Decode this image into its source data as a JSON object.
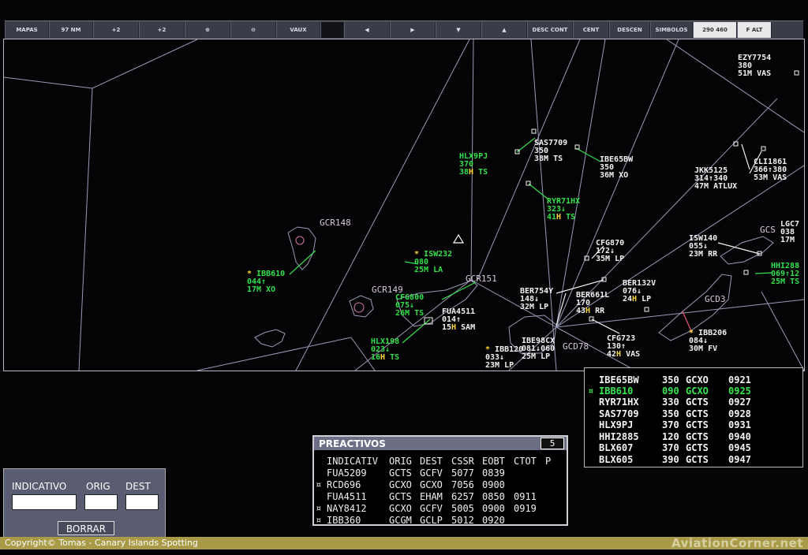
{
  "toolbar": {
    "buttons": [
      {
        "label": "MAPAS"
      },
      {
        "label": "97 NM"
      },
      {
        "label": "+2"
      },
      {
        "label": "+2"
      },
      {
        "label": "⊕"
      },
      {
        "label": "⊖"
      },
      {
        "label": "VAUX"
      },
      {
        "label": ""
      },
      {
        "label": "◀"
      },
      {
        "label": "▶"
      },
      {
        "label": "▼"
      },
      {
        "label": "▲"
      },
      {
        "label": "DESC CONT"
      },
      {
        "label": "CENT"
      },
      {
        "label": "DESCEN"
      },
      {
        "label": "SIMBOLOS"
      },
      {
        "label": "290 460"
      },
      {
        "label": "F ALT"
      }
    ]
  },
  "fixes": {
    "gcr148": "GCR148",
    "gcr149": "GCR149",
    "gcr151": "GCR151",
    "gcd78": "GCD78",
    "gcd3": "GCD3",
    "gcs": "GCS"
  },
  "tracks": {
    "ezy7754": {
      "l1": "EZY7754",
      "l2": "380",
      "l3": "51M VAS"
    },
    "cli1861": {
      "l1": "CLI1861",
      "l2": "366↑380",
      "l3": "53M VAS"
    },
    "jkk5125": {
      "l1": "JKK5125",
      "l2": "314↑340",
      "l3": "47M ATLUX"
    },
    "sas7709": {
      "l1": "SAS7709",
      "l2": "350",
      "l3": "38M TS"
    },
    "ibe65bw": {
      "l1": "IBE65BW",
      "l2": "350",
      "l3": "36M XO"
    },
    "hlx9pj": {
      "l1": "HLX9PJ",
      "l2": "370",
      "l3a": "38",
      "l3b": "H",
      "l3c": " TS"
    },
    "ryr71hx": {
      "l1": "RYR71HX",
      "l2": "323↓",
      "l3a": "41",
      "l3b": "H",
      "l3c": " TS"
    },
    "cfg870": {
      "l1": "CFG870",
      "l2": "172↓",
      "l3": "35M LP"
    },
    "isw140": {
      "l1": "ISW140",
      "l2": "055↓",
      "l3": "23M RR"
    },
    "lgc7": {
      "l1": "LGC7",
      "l2": "038",
      "l3": "17M"
    },
    "hhi288": {
      "l1": "HHI288",
      "l2": "069↑12",
      "l3": "25M TS"
    },
    "ibb610": {
      "l1": "IBB610",
      "l2": "044↑",
      "l3": "17M XO"
    },
    "isw232": {
      "l1": "ISW232",
      "l2": "080",
      "l3": "25M LA"
    },
    "cfg800": {
      "l1": "CFG800",
      "l2": "075↓",
      "l3": "26M TS"
    },
    "fua4511": {
      "l1": "FUA4511",
      "l2": "014↑",
      "l3a": "15",
      "l3b": "H",
      "l3c": " SAM"
    },
    "ber754y": {
      "l1": "BER754Y",
      "l2": "148↓",
      "l3": "32M LP"
    },
    "ber132v": {
      "l1": "BER132V",
      "l2": "076↓",
      "l3a": "24",
      "l3b": "H",
      "l3c": " LP"
    },
    "ber661l": {
      "l1": "BER661L",
      "l2": "170",
      "l3a": "43",
      "l3b": "H",
      "l3c": " RR"
    },
    "cfg723": {
      "l1": "CFG723",
      "l2": "130↑",
      "l3a": "42",
      "l3b": "H",
      "l3c": " VAS"
    },
    "ibb206": {
      "l1": "IBB206",
      "l2": "084↓",
      "l3": "30M FV"
    },
    "hlx198": {
      "l1": "HLX198",
      "l2": "023↓",
      "l3a": "16",
      "l3b": "H",
      "l3c": " TS"
    },
    "ibe98cx": {
      "l1": "IBE98CX",
      "l2": "081↓060",
      "l3": "25M LP"
    },
    "ibb120": {
      "l1": "IBB120",
      "l2": "033↓",
      "l3": "23M LP"
    }
  },
  "arrivals": {
    "rows": [
      {
        "callsign": "IBE65BW",
        "fl": "350",
        "dest": "GCXO",
        "time": "0921",
        "mark": ""
      },
      {
        "callsign": "IBB610",
        "fl": "090",
        "dest": "GCXO",
        "time": "0925",
        "mark": "¤"
      },
      {
        "callsign": "RYR71HX",
        "fl": "330",
        "dest": "GCTS",
        "time": "0927",
        "mark": ""
      },
      {
        "callsign": "SAS7709",
        "fl": "350",
        "dest": "GCTS",
        "time": "0928",
        "mark": ""
      },
      {
        "callsign": "HLX9PJ",
        "fl": "370",
        "dest": "GCTS",
        "time": "0931",
        "mark": ""
      },
      {
        "callsign": "HHI2885",
        "fl": "120",
        "dest": "GCTS",
        "time": "0940",
        "mark": ""
      },
      {
        "callsign": "BLX607",
        "fl": "370",
        "dest": "GCTS",
        "time": "0945",
        "mark": ""
      },
      {
        "callsign": "BLX605",
        "fl": "390",
        "dest": "GCTS",
        "time": "0947",
        "mark": ""
      }
    ]
  },
  "preactivos": {
    "title": "PREACTIVOS",
    "count": "5",
    "headers": {
      "indicativ": "INDICATIV",
      "orig": "ORIG",
      "dest": "DEST",
      "cssr": "CSSR",
      "eobt": "EOBT",
      "ctot": "CTOT",
      "p": "P"
    },
    "rows": [
      {
        "mark": "",
        "indicativ": "FUA5209",
        "orig": "GCTS",
        "dest": "GCFV",
        "cssr": "5077",
        "eobt": "0839",
        "ctot": ""
      },
      {
        "mark": "¤",
        "indicativ": "RCD696",
        "orig": "GCXO",
        "dest": "GCXO",
        "cssr": "7056",
        "eobt": "0900",
        "ctot": ""
      },
      {
        "mark": "",
        "indicativ": "FUA4511",
        "orig": "GCTS",
        "dest": "EHAM",
        "cssr": "6257",
        "eobt": "0850",
        "ctot": "0911"
      },
      {
        "mark": "¤",
        "indicativ": "NAY8412",
        "orig": "GCXO",
        "dest": "GCFV",
        "cssr": "5005",
        "eobt": "0900",
        "ctot": "0919"
      },
      {
        "mark": "¤",
        "indicativ": "IBB360",
        "orig": "GCGM",
        "dest": "GCLP",
        "cssr": "5012",
        "eobt": "0920",
        "ctot": ""
      }
    ]
  },
  "search": {
    "indicativo_label": "INDICATIVO",
    "orig_label": "ORIG",
    "dest_label": "DEST",
    "indicativo_value": "",
    "orig_value": "",
    "dest_value": "",
    "clear_label": "BORRAR"
  },
  "footer": {
    "copyright": "Copyright©  Tomas - Canary Islands Spotting",
    "brand": "AviationCorner.net"
  },
  "colors": {
    "assumed": "#34e04a",
    "unassumed": "#f2f2f2",
    "highlight": "#ffd83a",
    "toolbar": "#3a3d48",
    "footer": "#a89a47"
  }
}
